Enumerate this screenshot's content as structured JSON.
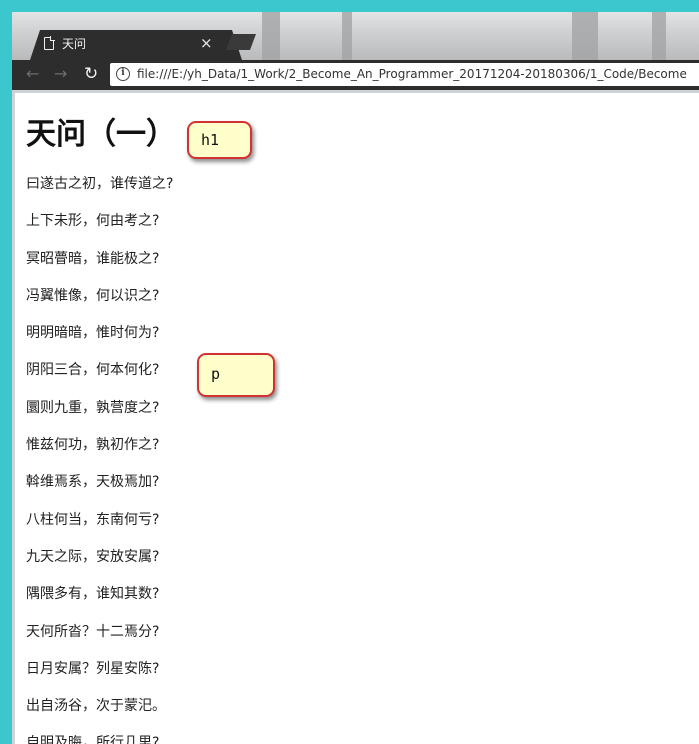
{
  "browser": {
    "tab_title": "天问",
    "tab_close": "×",
    "url": "file:///E:/yh_Data/1_Work/2_Become_An_Programmer_20171204-20180306/1_Code/Become",
    "icons": {
      "back": "arrow-left-icon",
      "forward": "arrow-right-icon",
      "reload": "reload-icon",
      "info": "info-icon",
      "page": "page-icon"
    }
  },
  "page": {
    "heading": "天问（一）",
    "lines": [
      "曰遂古之初，谁传道之?",
      "上下未形，何由考之?",
      "冥昭瞢暗，谁能极之?",
      "冯翼惟像，何以识之?",
      "明明暗暗，惟时何为?",
      "阴阳三合，何本何化?",
      "圜则九重，孰营度之?",
      "惟兹何功，孰初作之?",
      "斡维焉系，天极焉加?",
      "八柱何当，东南何亏?",
      "九天之际，安放安属?",
      "隅隈多有，谁知其数?",
      "天何所沓？十二焉分?",
      "日月安属？列星安陈?",
      "出自汤谷，次于蒙汜。",
      "自明及晦，所行几里?"
    ]
  },
  "annotations": {
    "h1_label": "h1",
    "p_label": "p",
    "border_color": "#d23232",
    "fill_color": "#ffffcc"
  }
}
